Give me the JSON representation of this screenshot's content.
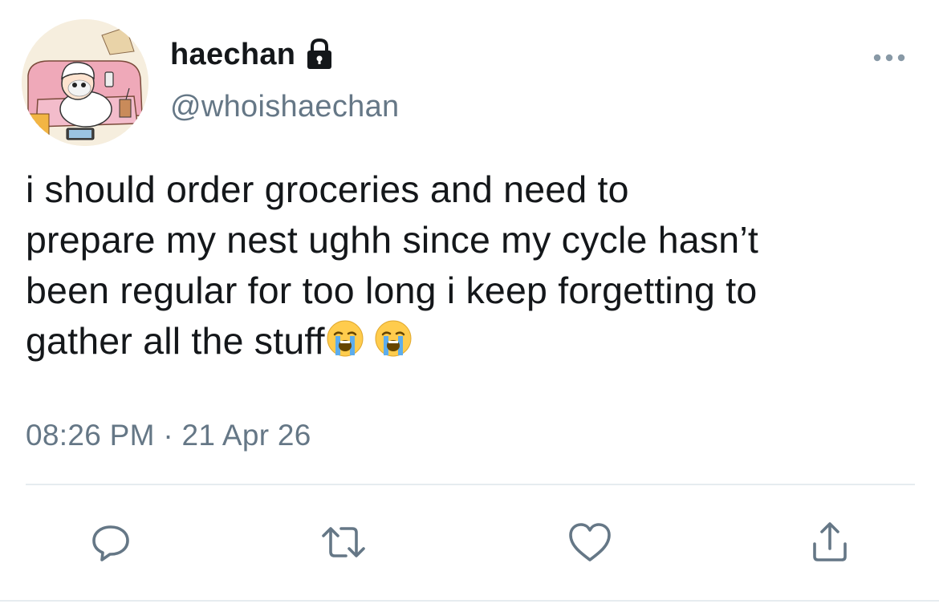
{
  "user": {
    "display_name": "haechan",
    "handle": "@whoishaechan",
    "protected": true
  },
  "tweet": {
    "text": "i should order groceries and need to\nprepare my nest ughh since my cycle hasn’t\nbeen regular for too long i keep forgetting to\ngather all the stuff",
    "emojis": [
      "loudly-crying-face",
      "loudly-crying-face"
    ],
    "timestamp": "08:26 PM · 21 Apr 26"
  },
  "actions": [
    {
      "name": "reply",
      "icon": "reply-icon"
    },
    {
      "name": "retweet",
      "icon": "retweet-icon"
    },
    {
      "name": "like",
      "icon": "heart-icon"
    },
    {
      "name": "share",
      "icon": "share-icon"
    }
  ],
  "colors": {
    "text": "#14171a",
    "secondary": "#657786",
    "icon": "#657786",
    "divider": "#e6ecf0",
    "background": "#ffffff"
  }
}
